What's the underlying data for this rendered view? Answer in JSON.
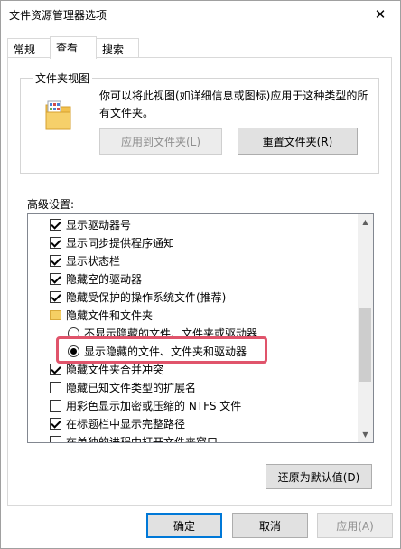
{
  "window": {
    "title": "文件资源管理器选项"
  },
  "tabs": [
    {
      "label": "常规"
    },
    {
      "label": "查看"
    },
    {
      "label": "搜索"
    }
  ],
  "folder_view": {
    "group_label": "文件夹视图",
    "description_line1": "你可以将此视图(如详细信息或图标)应用于这种类型的所",
    "description_line2": "有文件夹。",
    "apply_button": "应用到文件夹(L)",
    "reset_button": "重置文件夹(R)"
  },
  "advanced": {
    "label": "高级设置:",
    "items": [
      {
        "label": "显示驱动器号",
        "type": "checkbox",
        "checked": true
      },
      {
        "label": "显示同步提供程序通知",
        "type": "checkbox",
        "checked": true
      },
      {
        "label": "显示状态栏",
        "type": "checkbox",
        "checked": true
      },
      {
        "label": "隐藏空的驱动器",
        "type": "checkbox",
        "checked": true
      },
      {
        "label": "隐藏受保护的操作系统文件(推荐)",
        "type": "checkbox",
        "checked": true
      },
      {
        "label": "隐藏文件和文件夹",
        "type": "folder"
      },
      {
        "label": "不显示隐藏的文件、文件夹或驱动器",
        "type": "radio",
        "checked": false
      },
      {
        "label": "显示隐藏的文件、文件夹和驱动器",
        "type": "radio",
        "checked": true
      },
      {
        "label": "隐藏文件夹合并冲突",
        "type": "checkbox",
        "checked": true
      },
      {
        "label": "隐藏已知文件类型的扩展名",
        "type": "checkbox",
        "checked": false
      },
      {
        "label": "用彩色显示加密或压缩的 NTFS 文件",
        "type": "checkbox",
        "checked": false
      },
      {
        "label": "在标题栏中显示完整路径",
        "type": "checkbox",
        "checked": true
      },
      {
        "label": "在单独的进程中打开文件夹窗口",
        "type": "checkbox",
        "checked": false
      }
    ],
    "restore_button": "还原为默认值(D)"
  },
  "footer": {
    "ok": "确定",
    "cancel": "取消",
    "apply": "应用(A)"
  },
  "colors": {
    "highlight": "#e0546b",
    "default_button_border": "#0078d7"
  }
}
